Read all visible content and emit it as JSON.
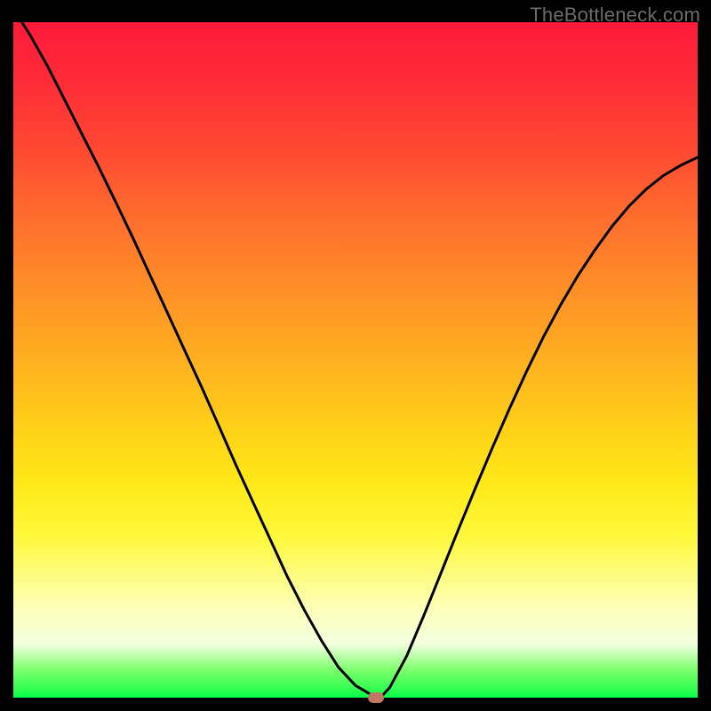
{
  "watermark": "TheBottleneck.com",
  "chart_data": {
    "type": "line",
    "title": "",
    "xlabel": "",
    "ylabel": "",
    "xlim": [
      0,
      1
    ],
    "ylim": [
      0,
      1
    ],
    "x": [
      0.0,
      0.025,
      0.05,
      0.075,
      0.1,
      0.125,
      0.15,
      0.175,
      0.2,
      0.225,
      0.25,
      0.275,
      0.3,
      0.325,
      0.35,
      0.375,
      0.4,
      0.425,
      0.45,
      0.475,
      0.5,
      0.525,
      0.53,
      0.54,
      0.55,
      0.575,
      0.6,
      0.625,
      0.65,
      0.675,
      0.7,
      0.725,
      0.75,
      0.775,
      0.8,
      0.825,
      0.85,
      0.875,
      0.9,
      0.925,
      0.95,
      0.975,
      1.0
    ],
    "y": [
      1.02,
      0.98,
      0.935,
      0.885,
      0.835,
      0.785,
      0.733,
      0.68,
      0.625,
      0.57,
      0.515,
      0.46,
      0.403,
      0.345,
      0.29,
      0.235,
      0.18,
      0.13,
      0.085,
      0.045,
      0.018,
      0.003,
      0.0,
      0.004,
      0.015,
      0.062,
      0.122,
      0.185,
      0.248,
      0.31,
      0.37,
      0.428,
      0.483,
      0.535,
      0.582,
      0.625,
      0.663,
      0.698,
      0.728,
      0.753,
      0.773,
      0.788,
      0.8
    ],
    "marker": {
      "x": 0.53,
      "y": 0.0
    },
    "annotations": []
  },
  "colors": {
    "curve": "#000000",
    "marker": "#c17761",
    "background_frame": "#000000"
  }
}
